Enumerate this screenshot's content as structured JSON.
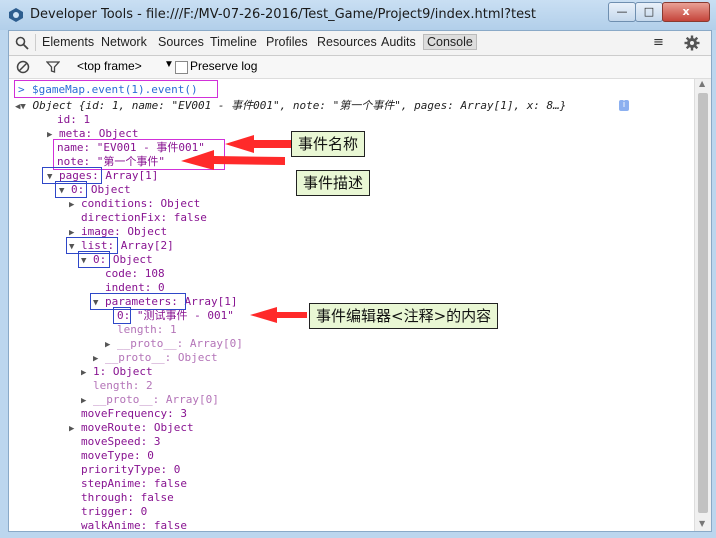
{
  "window": {
    "title": "Developer Tools - file:///F:/MV-07-26-2016/Test_Game/Project9/index.html?test",
    "min_label": "—",
    "max_label": "□",
    "close_label": "x"
  },
  "tabs": [
    "Elements",
    "Network",
    "Sources",
    "Timeline",
    "Profiles",
    "Resources",
    "Audits",
    "Console"
  ],
  "active_tab": "Console",
  "filter": {
    "frame": "<top frame>",
    "preserve_log": "Preserve log"
  },
  "console": {
    "prompt": ">",
    "command": "$gameMap.event(1).event()",
    "lines": [
      {
        "t": "Object {id: 1, name: \"EV001 - 事件001\", note: \"第一个事件\", pages: Array[1], x: 8…}"
      },
      {
        "t": "id: 1"
      },
      {
        "t": "meta: Object"
      },
      {
        "t": "name: \"EV001 - 事件001\""
      },
      {
        "t": "note: \"第一个事件\""
      },
      {
        "t": "pages: Array[1]"
      },
      {
        "t": "0: Object"
      },
      {
        "t": "conditions: Object"
      },
      {
        "t": "directionFix: false"
      },
      {
        "t": "image: Object"
      },
      {
        "t": "list: Array[2]"
      },
      {
        "t": "0: Object"
      },
      {
        "t": "code: 108"
      },
      {
        "t": "indent: 0"
      },
      {
        "t": "parameters: Array[1]"
      },
      {
        "t": "0: \"测试事件 - 001\""
      },
      {
        "t": "length: 1"
      },
      {
        "t": "__proto__: Array[0]"
      },
      {
        "t": "__proto__: Object"
      },
      {
        "t": "1: Object"
      },
      {
        "t": "length: 2"
      },
      {
        "t": "__proto__: Array[0]"
      },
      {
        "t": "moveFrequency: 3"
      },
      {
        "t": "moveRoute: Object"
      },
      {
        "t": "moveSpeed: 3"
      },
      {
        "t": "moveType: 0"
      },
      {
        "t": "priorityType: 0"
      },
      {
        "t": "stepAnime: false"
      },
      {
        "t": "through: false"
      },
      {
        "t": "trigger: 0"
      },
      {
        "t": "walkAnime: false"
      }
    ]
  },
  "annotations": {
    "event_name": "事件名称",
    "event_desc": "事件描述",
    "editor_note": "事件编辑器<注释>的内容"
  },
  "colors": {
    "key": "#881391",
    "string": "#c41a16",
    "number": "#1c00cf",
    "arrow": "#ff2a2a",
    "callout_bg": "#e9f7d4"
  }
}
